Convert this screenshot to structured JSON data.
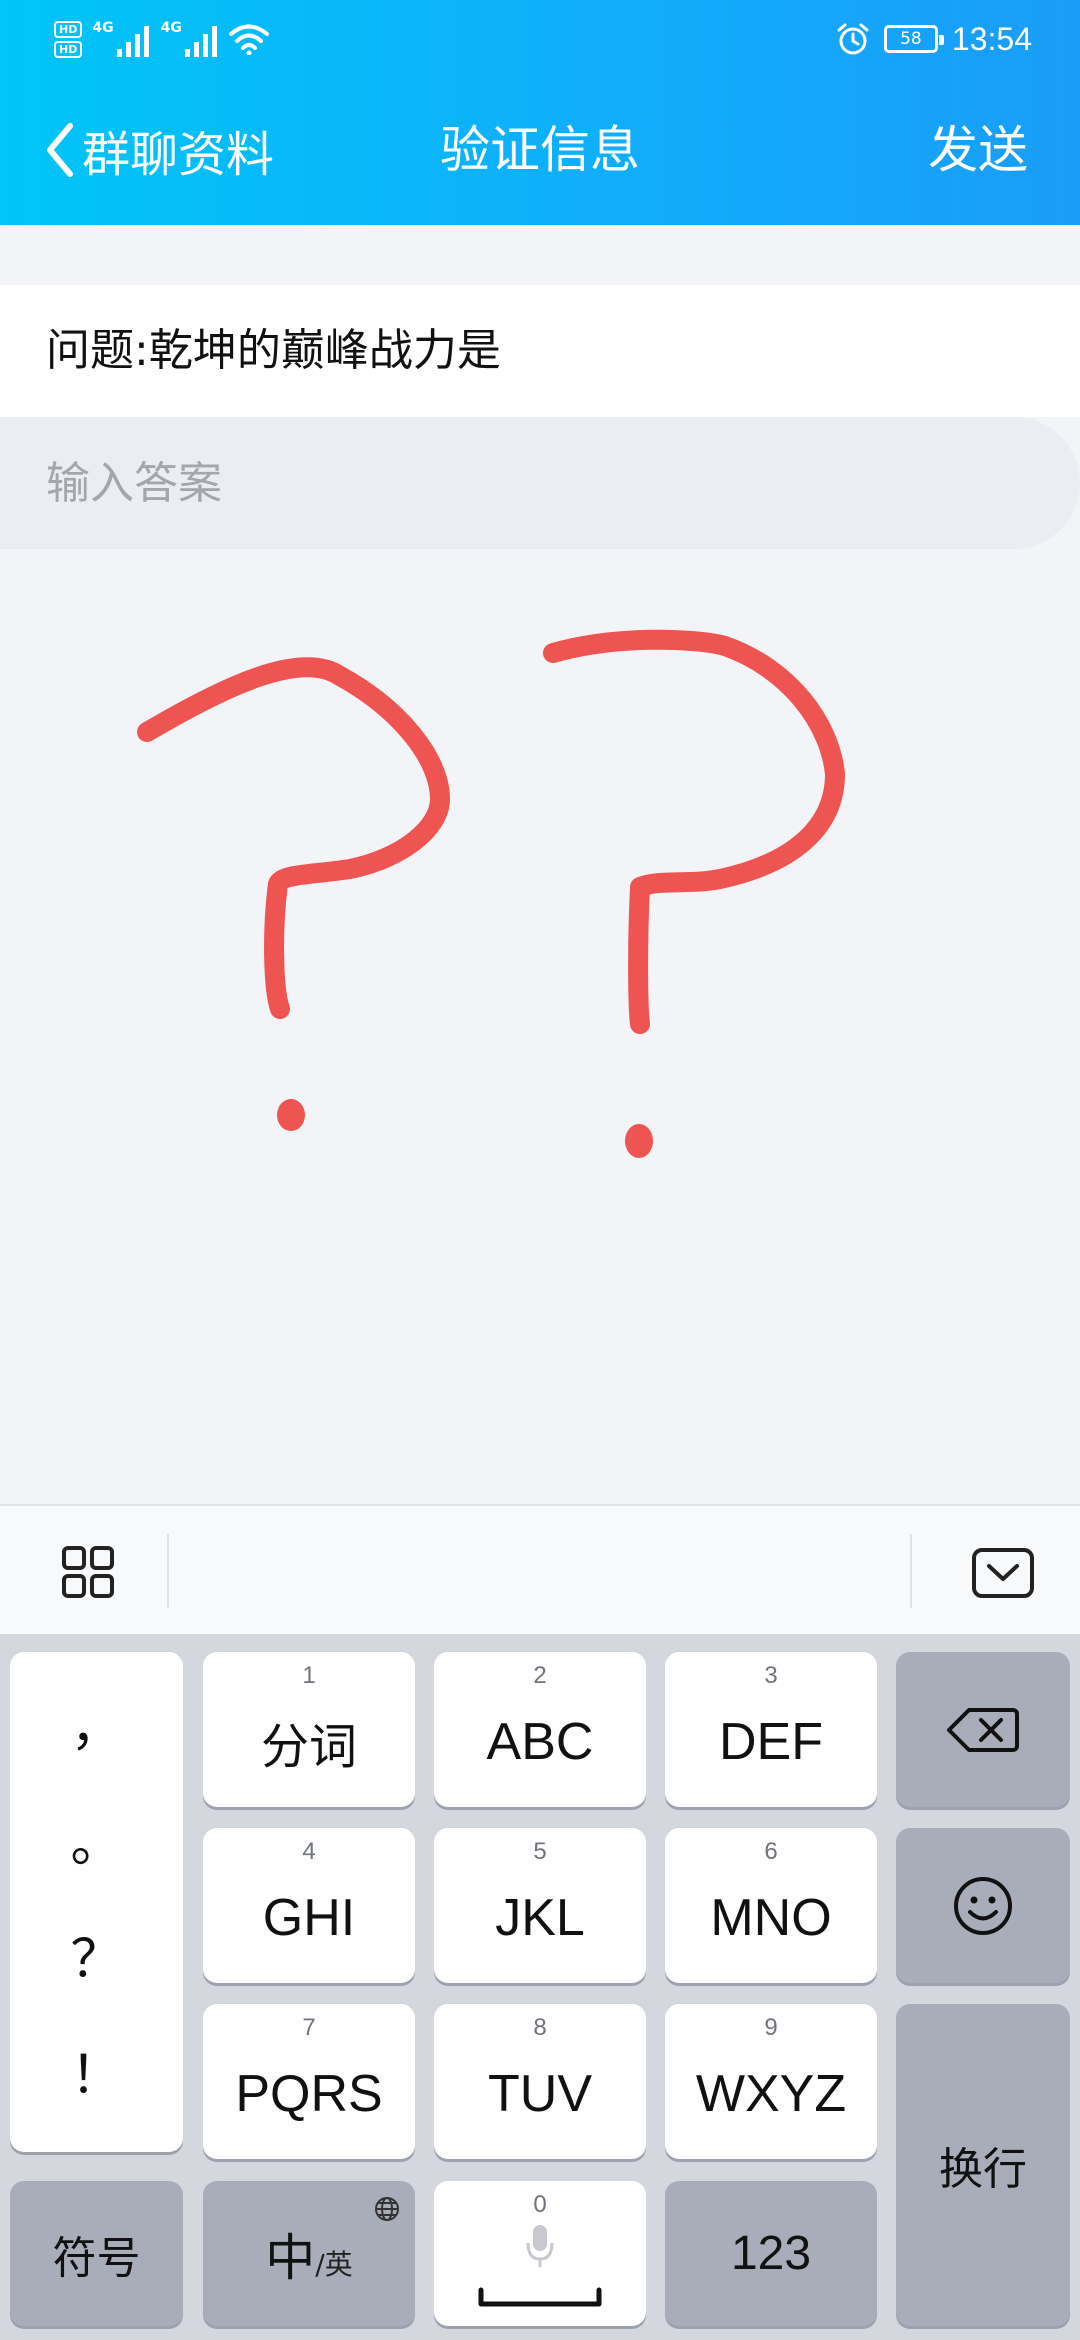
{
  "status_bar": {
    "hd_badges": [
      "HD",
      "HD"
    ],
    "network_labels": [
      "4G",
      "4G"
    ],
    "battery_level": "58",
    "time": "13:54"
  },
  "nav": {
    "back_label": "群聊资料",
    "title": "验证信息",
    "send_label": "发送"
  },
  "question": "问题:乾坤的巅峰战力是",
  "answer": {
    "placeholder": "输入答案",
    "value": ""
  },
  "keyboard": {
    "punctuation": [
      "，",
      "。",
      "？",
      "！"
    ],
    "keys": [
      {
        "num": "1",
        "label": "分词"
      },
      {
        "num": "2",
        "label": "ABC"
      },
      {
        "num": "3",
        "label": "DEF"
      },
      {
        "num": "4",
        "label": "GHI"
      },
      {
        "num": "5",
        "label": "JKL"
      },
      {
        "num": "6",
        "label": "MNO"
      },
      {
        "num": "7",
        "label": "PQRS"
      },
      {
        "num": "8",
        "label": "TUV"
      },
      {
        "num": "9",
        "label": "WXYZ"
      }
    ],
    "symbols_label": "符号",
    "lang_main": "中",
    "lang_sub": "/英",
    "space_num": "0",
    "numbers_label": "123",
    "enter_label": "换行"
  },
  "colors": {
    "header_gradient_start": "#00c5f7",
    "header_gradient_end": "#1a9df8",
    "doodle_red": "#ee5452",
    "keyboard_bg": "#d4d7de",
    "func_key": "#a8adb9"
  }
}
